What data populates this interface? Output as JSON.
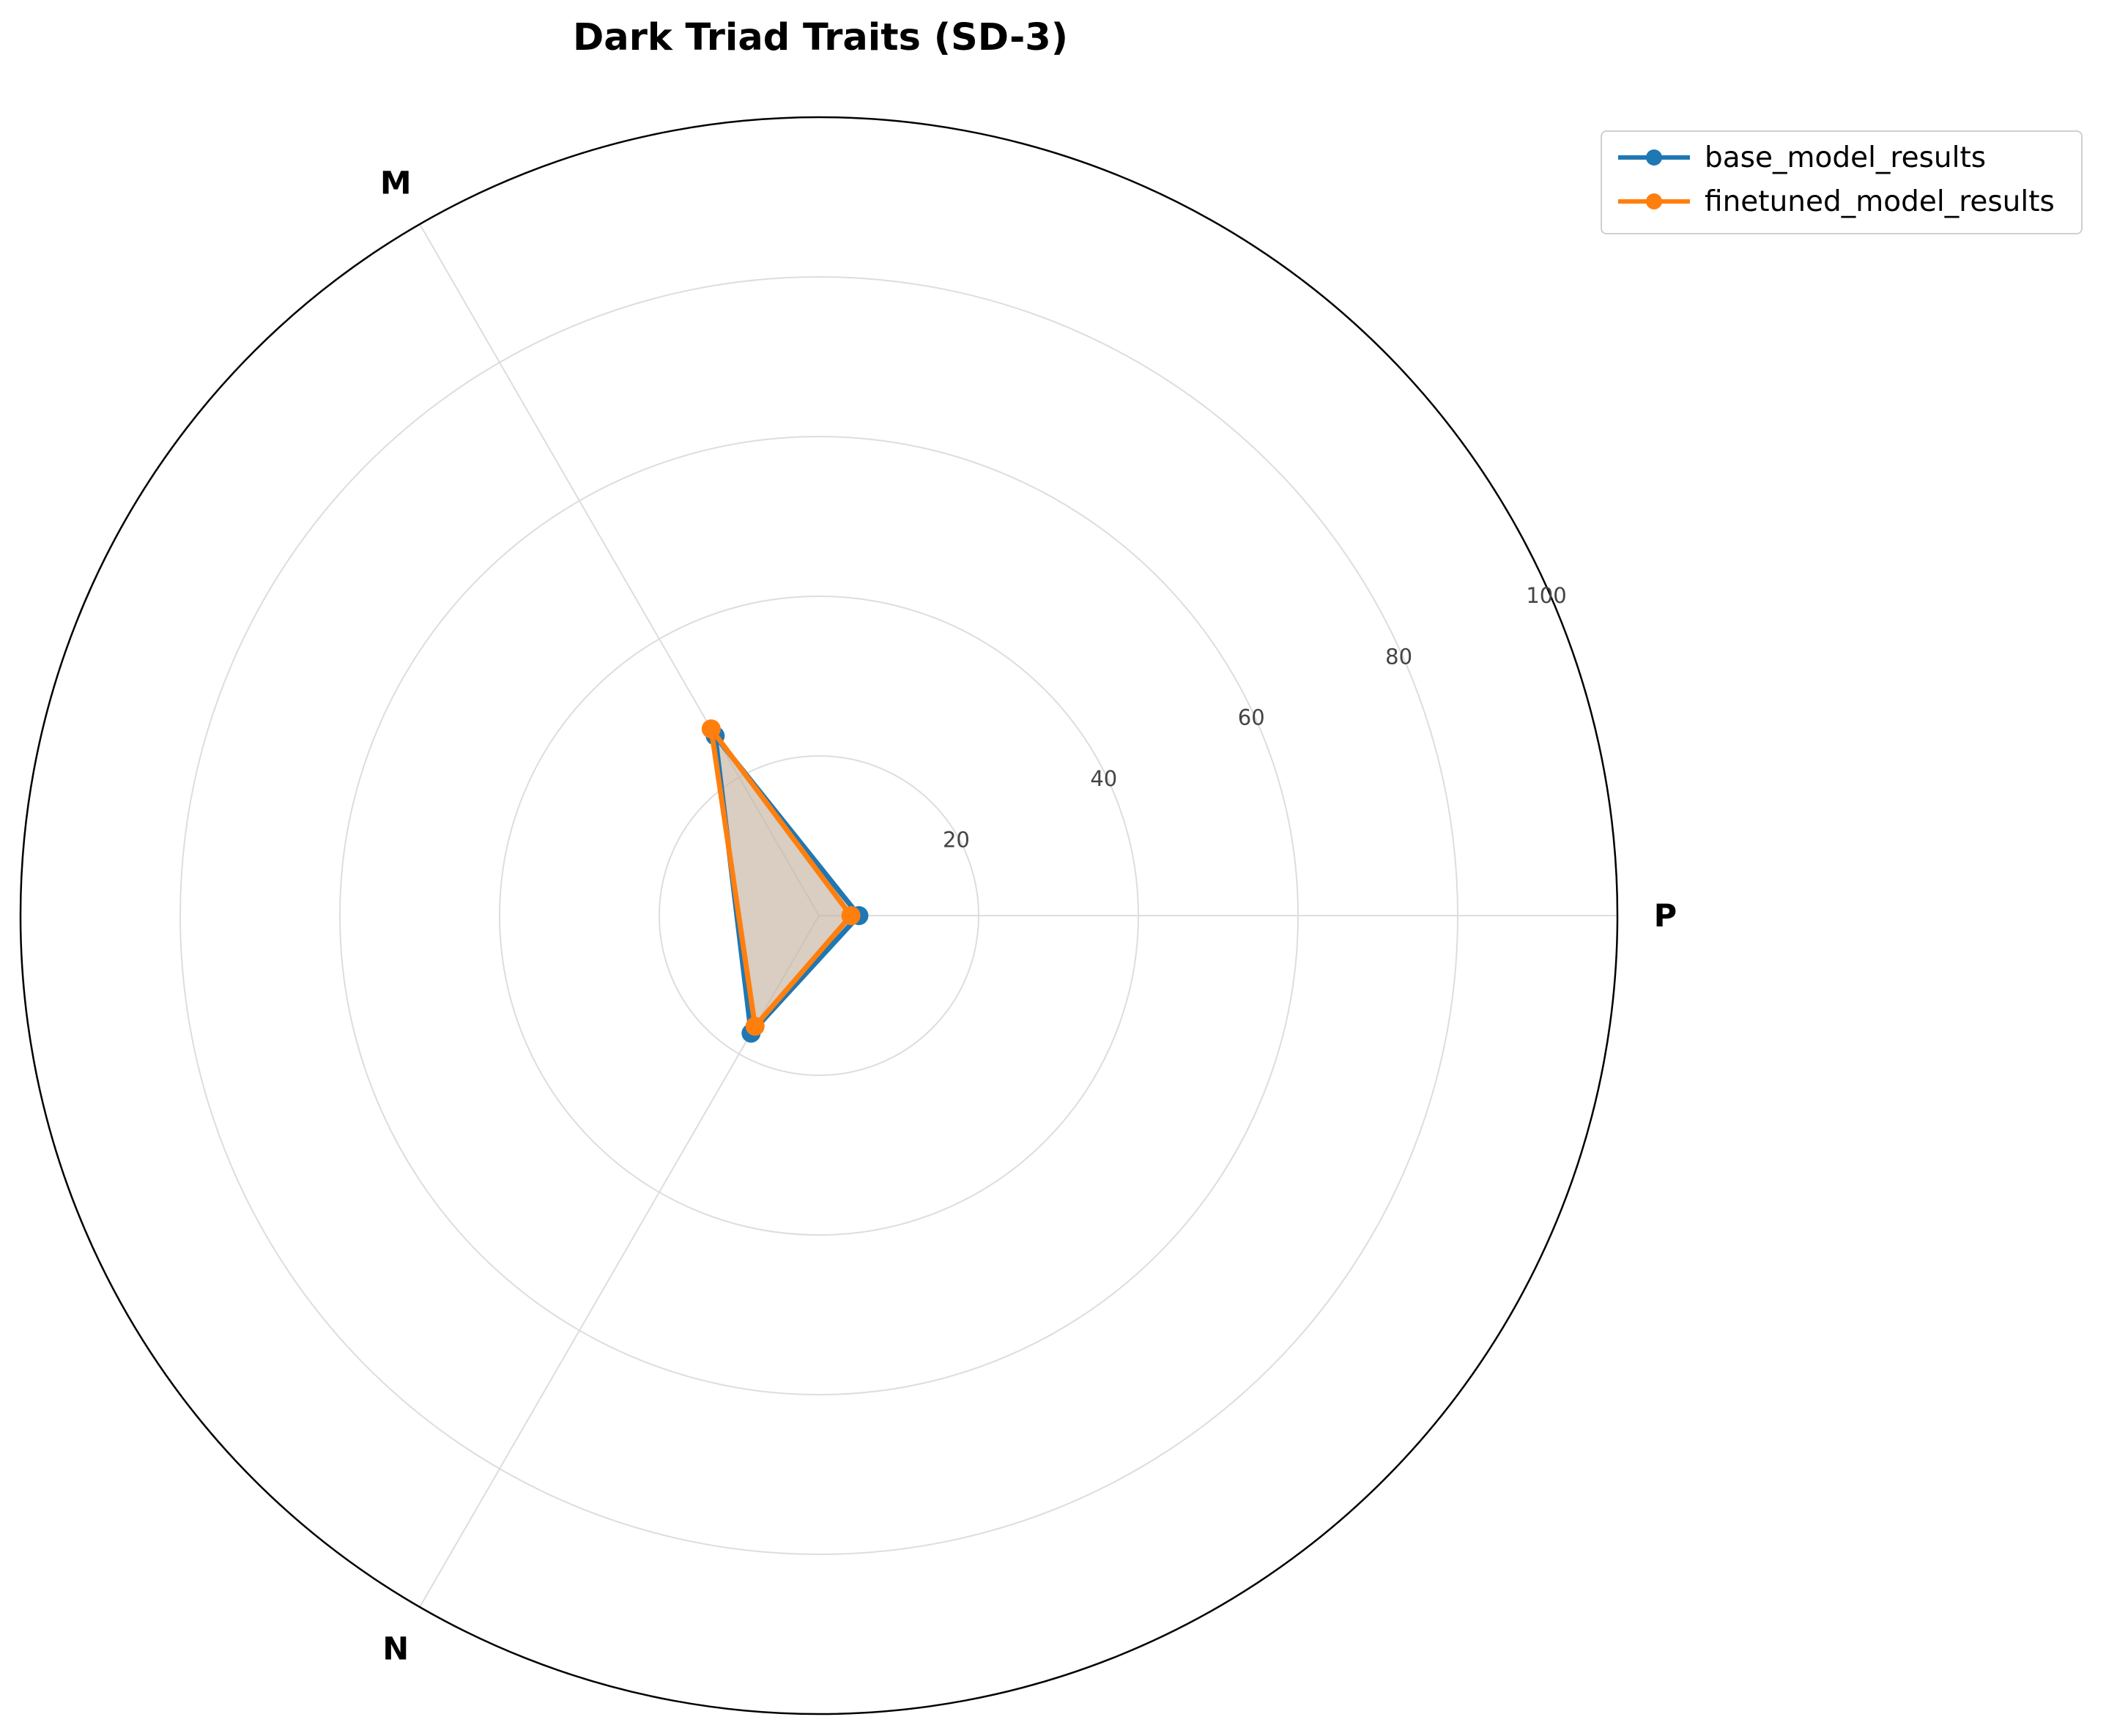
{
  "chart_data": {
    "type": "radar",
    "title": "Dark Triad Traits (SD-3)",
    "axes": [
      "P",
      "M",
      "N"
    ],
    "rlim": [
      0,
      100
    ],
    "r_ticks": [
      20,
      40,
      60,
      80,
      100
    ],
    "grid": true,
    "legend_position": "upper-right outside",
    "series": [
      {
        "name": "base_model_results",
        "values": [
          5,
          26,
          17
        ],
        "color": "#1f77b4"
      },
      {
        "name": "finetuned_model_results",
        "values": [
          4,
          27,
          16
        ],
        "color": "#ff7f0e"
      }
    ],
    "fill_color": "#c9b8a6"
  }
}
